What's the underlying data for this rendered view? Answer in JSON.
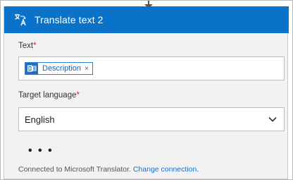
{
  "action": {
    "title": "Translate text 2",
    "icon": "translate-icon"
  },
  "fields": {
    "text": {
      "label": "Text",
      "required_mark": "*",
      "token": {
        "label": "Description",
        "remove": "×",
        "icon": "dynamic-content-icon"
      }
    },
    "target_language": {
      "label": "Target language",
      "required_mark": "*",
      "value": "English",
      "icon": "chevron-down-icon"
    }
  },
  "more_options": "• • •",
  "footer": {
    "prefix": "Connected to Microsoft Translator.",
    "link": "Change connection."
  },
  "colors": {
    "header_bg": "#0a73c9",
    "link": "#1a6fc6",
    "required": "#dd2222"
  }
}
